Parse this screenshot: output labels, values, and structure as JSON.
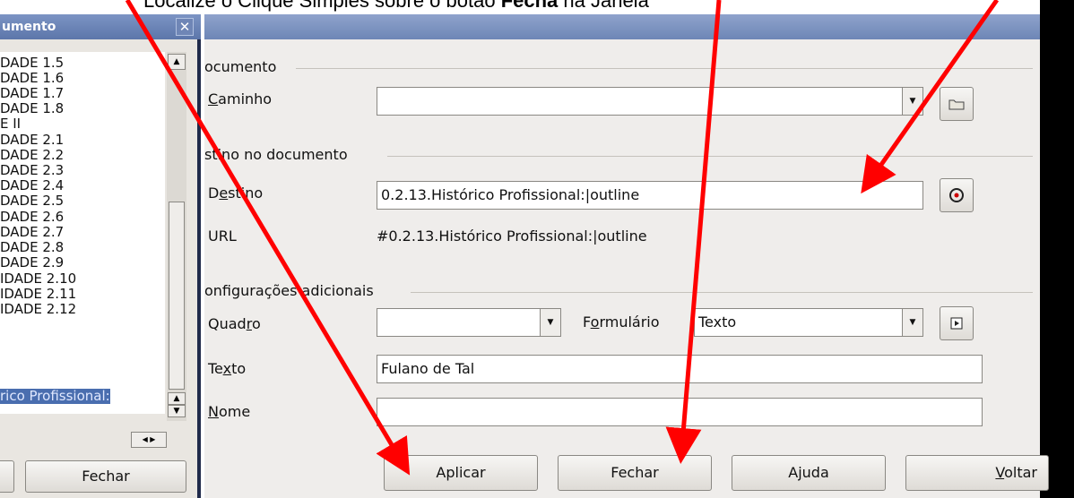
{
  "instruction": {
    "prefix": "Localize o Clique Simples sobre o botão ",
    "bold": "Fecha",
    "suffix": " na Janela"
  },
  "navigator": {
    "title": "umento",
    "close_glyph": "✕",
    "items": [
      "DADE 1.5",
      "DADE 1.6",
      "DADE 1.7",
      "DADE 1.8",
      "E II",
      "DADE 2.1",
      "DADE 2.2",
      "DADE 2.3",
      "DADE 2.4",
      "DADE 2.5",
      "DADE 2.6",
      "DADE 2.7",
      "DADE 2.8",
      "DADE 2.9",
      "IDADE 2.10",
      "IDADE 2.11",
      "IDADE 2.12"
    ],
    "selected_item": "rico Profissional:",
    "close_button": "Fechar"
  },
  "dialog": {
    "document_section": "ocumento",
    "path_label": "Caminho",
    "path_value": "",
    "target_section": "stino no documento",
    "target_label": "Destino",
    "target_value": "0.2.13.Histórico Profissional:|outline",
    "url_label": "URL",
    "url_value": "#0.2.13.Histórico Profissional:|outline",
    "extra_section": "onfigurações adicionais",
    "frame_label": "Quadro",
    "frame_value": "",
    "form_label": "Formulário",
    "form_value": "Texto",
    "text_label": "Texto",
    "text_value": "Fulano de Tal",
    "name_label": "Nome",
    "name_value": "",
    "buttons": {
      "apply": "Aplicar",
      "close": "Fechar",
      "help": "Ajuda",
      "back": "Voltar"
    }
  },
  "colors": {
    "arrow": "#ff0000",
    "titlebar": "#6d86b6",
    "selection": "#4a6eaf"
  }
}
